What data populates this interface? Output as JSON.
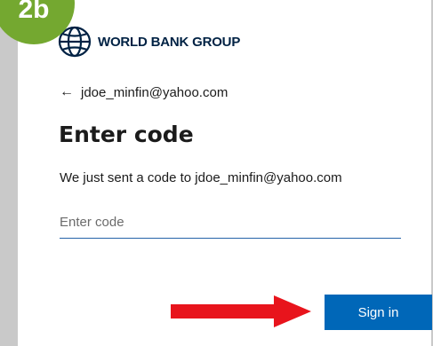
{
  "step_badge": "2b",
  "brand": {
    "name": "WORLD BANK GROUP",
    "logo_icon": "globe-icon",
    "color": "#002244"
  },
  "back": {
    "arrow": "←",
    "account": "jdoe_minfin@yahoo.com"
  },
  "heading": "Enter code",
  "message": "We just sent a code to jdoe_minfin@yahoo.com",
  "code_input": {
    "value": "",
    "placeholder": "Enter code"
  },
  "sign_in_label": "Sign in",
  "colors": {
    "primary": "#0067b8",
    "badge": "#74a830",
    "arrow": "#e8141c"
  }
}
